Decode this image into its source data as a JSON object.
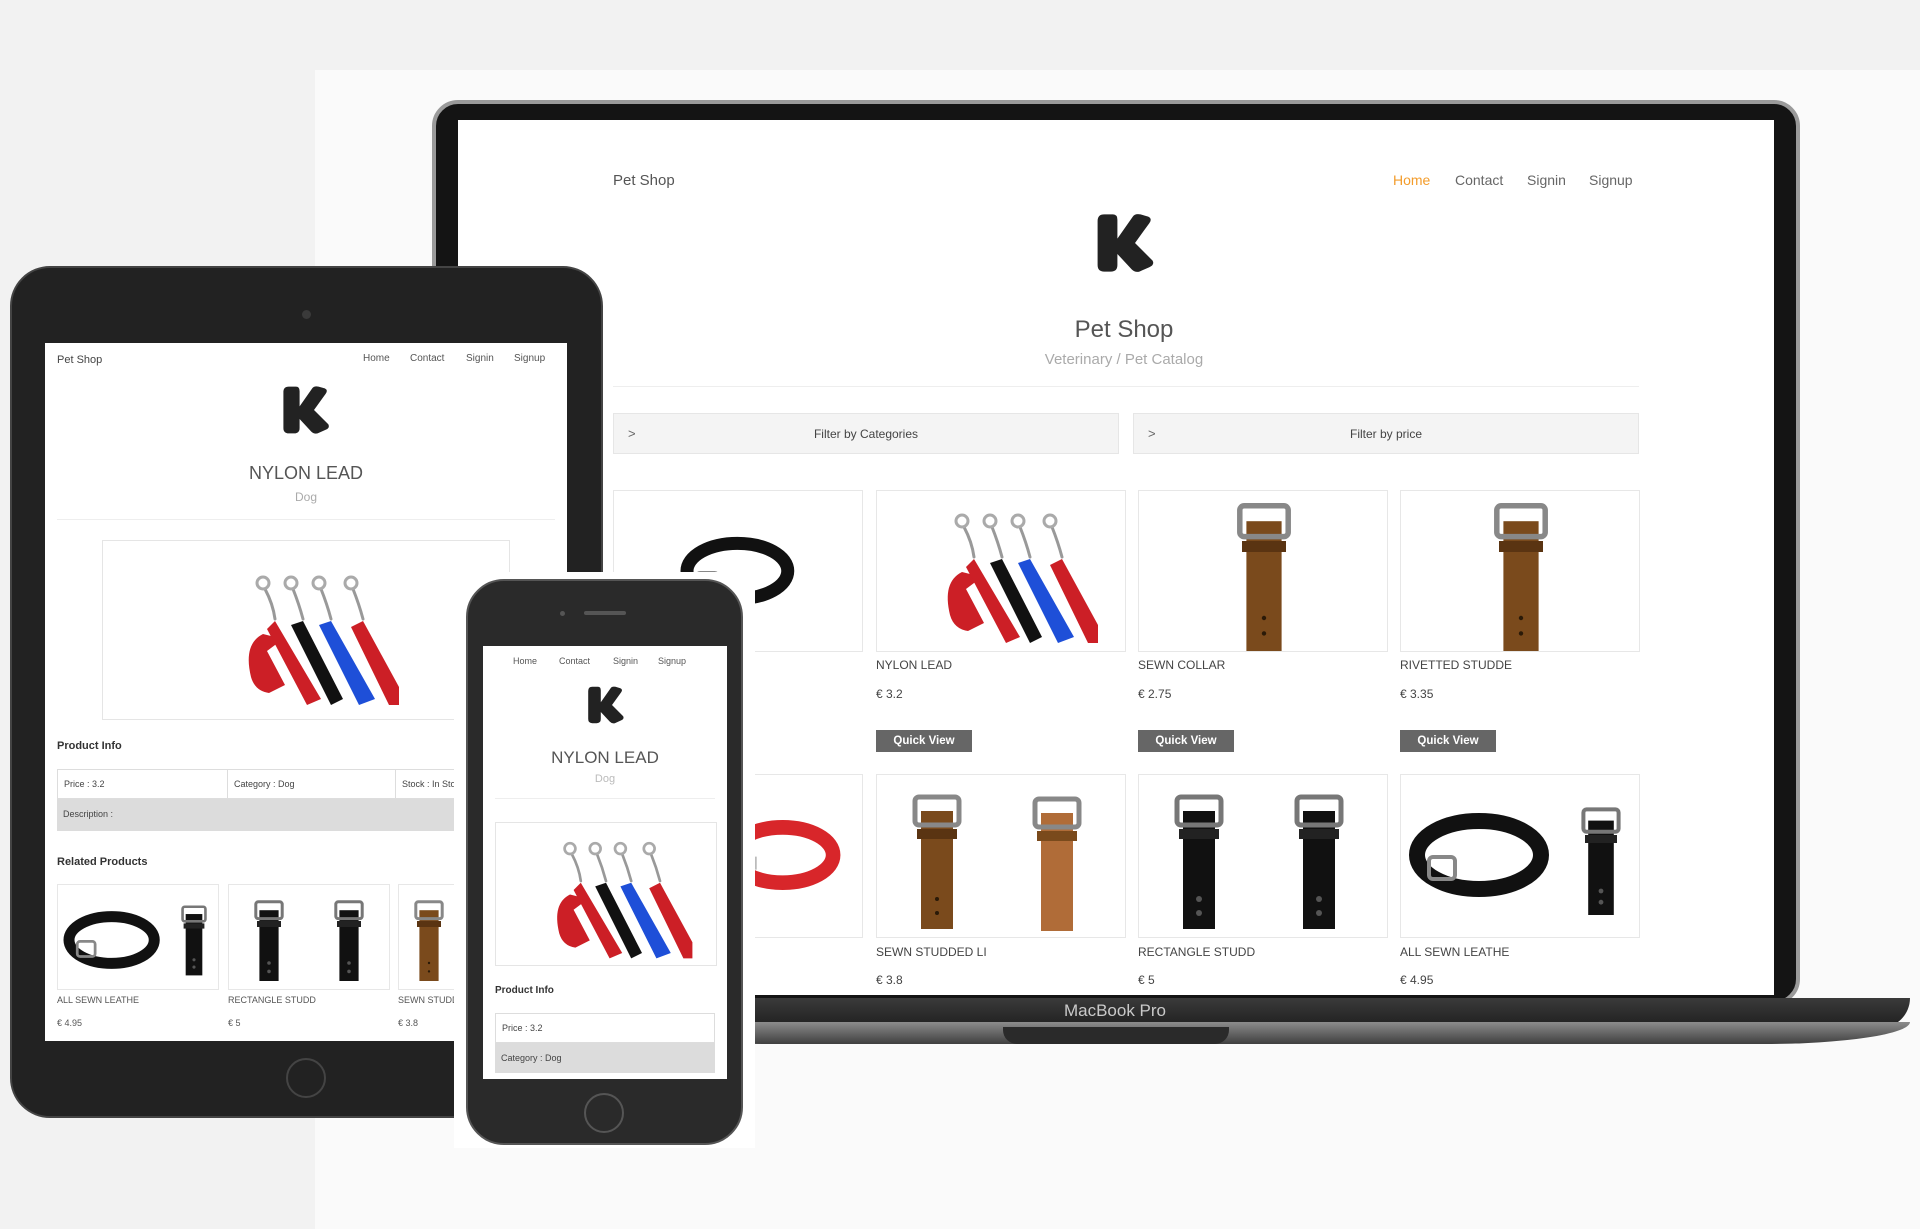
{
  "site": {
    "brand": "Pet Shop",
    "subtitle": "Veterinary / Pet Catalog",
    "logo_letter": "K"
  },
  "nav": {
    "home": "Home",
    "contact": "Contact",
    "signin": "Signin",
    "signup": "Signup",
    "active_color": "#f39c2b"
  },
  "filters": {
    "categories": "Filter by Categories",
    "price": "Filter by price"
  },
  "products": [
    {
      "name": "",
      "price": ""
    },
    {
      "name": "NYLON LEAD",
      "price": "€ 3.2"
    },
    {
      "name": "SEWN COLLAR",
      "price": "€ 2.75"
    },
    {
      "name": "RIVETTED STUDDE",
      "price": "€ 3.35"
    },
    {
      "name": "",
      "price": ""
    },
    {
      "name": "SEWN STUDDED LI",
      "price": "€ 3.8"
    },
    {
      "name": "RECTANGLE STUDD",
      "price": "€ 5"
    },
    {
      "name": "ALL SEWN LEATHE",
      "price": "€ 4.95"
    }
  ],
  "quick_view": "Quick View",
  "device_label": "MacBook Pro",
  "detail": {
    "title": "NYLON LEAD",
    "category_name": "Dog",
    "product_info": "Product Info",
    "price_label": "Price :",
    "price_value": "3.2",
    "category_label": "Category :",
    "category_value": "Dog",
    "stock_label": "Stock :",
    "stock_value": "In Stock",
    "description_label": "Description :",
    "related_title": "Related Products",
    "related": [
      {
        "name": "ALL SEWN LEATHE",
        "price": "€ 4.95"
      },
      {
        "name": "RECTANGLE STUDD",
        "price": "€ 5"
      },
      {
        "name": "SEWN STUDD",
        "price": "€ 3.8"
      }
    ]
  }
}
